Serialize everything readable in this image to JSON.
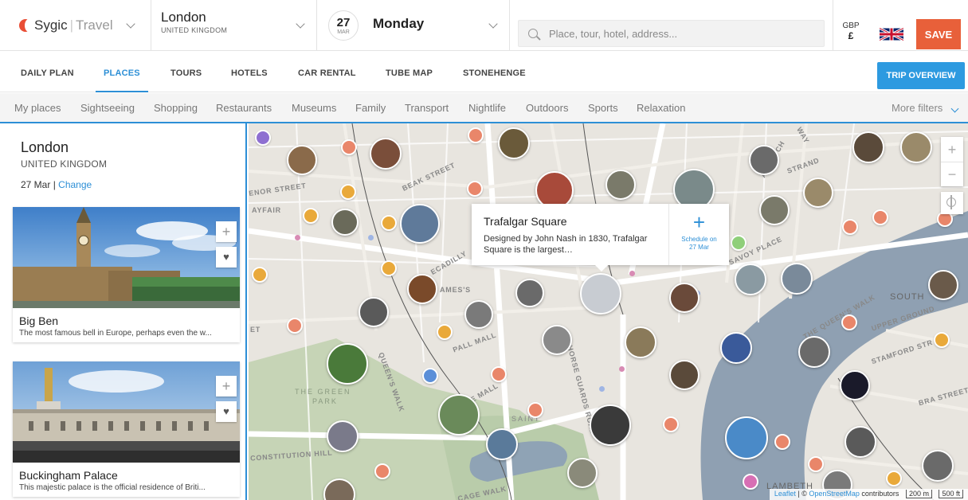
{
  "header": {
    "brand_name": "Sygic",
    "brand_sep": "|",
    "brand_sub": "Travel",
    "city_name": "London",
    "city_country": "UNITED KINGDOM",
    "date_day": "27",
    "date_month": "MAR",
    "weekday": "Monday",
    "search_placeholder": "Place, tour, hotel, address...",
    "currency_code": "GBP",
    "currency_symbol": "£",
    "save_label": "SAVE",
    "accent_color": "#e8603a"
  },
  "tabs": {
    "items": [
      {
        "label": "DAILY PLAN"
      },
      {
        "label": "PLACES"
      },
      {
        "label": "TOURS"
      },
      {
        "label": "HOTELS"
      },
      {
        "label": "CAR RENTAL"
      },
      {
        "label": "TUBE MAP"
      },
      {
        "label": "STONEHENGE"
      }
    ],
    "active": "PLACES",
    "overview_label": "TRIP OVERVIEW",
    "active_color": "#2d8fd6"
  },
  "filters": {
    "items": [
      {
        "label": "My places"
      },
      {
        "label": "Sightseeing"
      },
      {
        "label": "Shopping"
      },
      {
        "label": "Restaurants"
      },
      {
        "label": "Museums"
      },
      {
        "label": "Family"
      },
      {
        "label": "Transport"
      },
      {
        "label": "Nightlife"
      },
      {
        "label": "Outdoors"
      },
      {
        "label": "Sports"
      },
      {
        "label": "Relaxation"
      }
    ],
    "more_label": "More filters"
  },
  "sidebar": {
    "city": "London",
    "country": "UNITED KINGDOM",
    "date": "27 Mar",
    "date_sep": " | ",
    "change_label": "Change",
    "cards": [
      {
        "title": "Big Ben",
        "description": "The most famous bell in Europe, perhaps even the w..."
      },
      {
        "title": "Buckingham Palace",
        "description": "This majestic palace is the official residence of Briti..."
      }
    ]
  },
  "map": {
    "popup": {
      "title": "Trafalgar Square",
      "description": "Designed by John Nash in 1830, Trafalgar Square is the largest…",
      "schedule_line1": "Schedule on",
      "schedule_line2": "27 Mar"
    },
    "labels": {
      "beak": "BEAK STREET",
      "enor": "ENOR STREET",
      "mayfair": "AYFAIR",
      "piccadilly": "ECADILLY",
      "james": "AMES'S",
      "pallmall": "PALL MALL",
      "mall": "HE MALL",
      "greenpark1": "THE GREEN",
      "greenpark2": "PARK",
      "queenswalk": "QUEEN'S WALK",
      "horseguards": "HORSE GUARDS ROAD",
      "constitution": "CONSTITUTION HILL",
      "cagewalk": "CAGE WALK",
      "saint": "SAINT",
      "strand": "STRAND",
      "aldwych": "ALDWYCH",
      "savoy": "SAVOY PLACE",
      "queenswalk2": "THE QUEEN'S WALK",
      "south": "SOUTH",
      "uppergr": "UPPER GROUND",
      "stamford": "STAMFORD STR",
      "lambeth": "LAMBETH",
      "brastreet": "BRA STREET",
      "way": "WAY",
      "et": "ET"
    },
    "zoom_in": "+",
    "zoom_out": "−",
    "attribution_leaflet": "Leaflet",
    "attribution_sep": " | © ",
    "attribution_osm": "OpenStreetMap",
    "attribution_rest": " contributors",
    "scale_m": "200 m",
    "scale_ft": "500 ft"
  }
}
